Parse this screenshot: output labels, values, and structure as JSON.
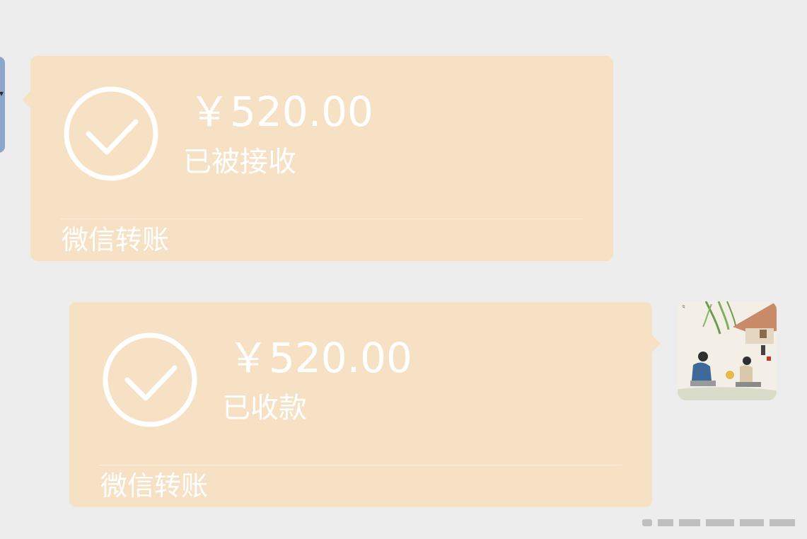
{
  "messages": [
    {
      "direction": "received",
      "amount": "￥520.00",
      "status": "已被接收",
      "footer": "微信转账"
    },
    {
      "direction": "sent",
      "amount": "￥520.00",
      "status": "已收款",
      "footer": "微信转账"
    }
  ],
  "icons": {
    "transfer_status": "check-circle-icon"
  },
  "colors": {
    "chat_background": "#ededed",
    "transfer_bubble": "#f6e1c5",
    "text": "#ffffff",
    "contact_avatar": "#8ca6cc"
  }
}
